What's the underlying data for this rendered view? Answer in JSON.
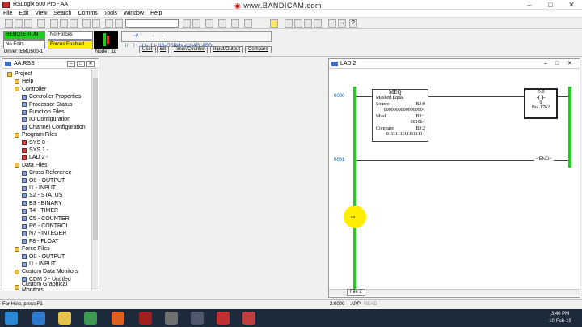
{
  "window": {
    "title": "RSLogix 500 Pro - AA",
    "overlay": "www.BANDICAM.com"
  },
  "menu": [
    "File",
    "Edit",
    "View",
    "Search",
    "Comms",
    "Tools",
    "Window",
    "Help"
  ],
  "status_panel": {
    "mode": "REMOTE RUN",
    "forces": "No Forces",
    "edits": "No Edits",
    "forces_enabled": "Forces Enabled",
    "driver": "Driver: EMU500-1",
    "node": "Node : 1d"
  },
  "rung_toolbar": [
    "⊣⊢",
    "⊣/⊢",
    "-( )-",
    "-(L)-",
    "-(U)-",
    "OSR",
    "<I>",
    "<U>",
    "ABL",
    "ABS"
  ],
  "instruction_tabs": [
    "User",
    "Bit",
    "Timer/Counter",
    "Input/Output",
    "Compare"
  ],
  "project": {
    "title": "AA.RSS",
    "items": [
      {
        "label": "Project",
        "indent": 0,
        "icon": "f"
      },
      {
        "label": "Help",
        "indent": 1,
        "icon": "f"
      },
      {
        "label": "Controller",
        "indent": 1,
        "icon": "f"
      },
      {
        "label": "Controller Properties",
        "indent": 2,
        "icon": "d"
      },
      {
        "label": "Processor Status",
        "indent": 2,
        "icon": "d"
      },
      {
        "label": "Function Files",
        "indent": 2,
        "icon": "d"
      },
      {
        "label": "IO Configuration",
        "indent": 2,
        "icon": "d"
      },
      {
        "label": "Channel Configuration",
        "indent": 2,
        "icon": "d"
      },
      {
        "label": "Program Files",
        "indent": 1,
        "icon": "f"
      },
      {
        "label": "SYS 0 -",
        "indent": 2,
        "icon": "r"
      },
      {
        "label": "SYS 1 -",
        "indent": 2,
        "icon": "r"
      },
      {
        "label": "LAD 2 -",
        "indent": 2,
        "icon": "r"
      },
      {
        "label": "Data Files",
        "indent": 1,
        "icon": "f"
      },
      {
        "label": "Cross Reference",
        "indent": 2,
        "icon": "d"
      },
      {
        "label": "O0 - OUTPUT",
        "indent": 2,
        "icon": "d"
      },
      {
        "label": "I1 - INPUT",
        "indent": 2,
        "icon": "d"
      },
      {
        "label": "S2 - STATUS",
        "indent": 2,
        "icon": "d"
      },
      {
        "label": "B3 - BINARY",
        "indent": 2,
        "icon": "d"
      },
      {
        "label": "T4 - TIMER",
        "indent": 2,
        "icon": "d"
      },
      {
        "label": "C5 - COUNTER",
        "indent": 2,
        "icon": "d"
      },
      {
        "label": "R6 - CONTROL",
        "indent": 2,
        "icon": "d"
      },
      {
        "label": "N7 - INTEGER",
        "indent": 2,
        "icon": "d"
      },
      {
        "label": "F8 - FLOAT",
        "indent": 2,
        "icon": "d"
      },
      {
        "label": "Force Files",
        "indent": 1,
        "icon": "f"
      },
      {
        "label": "O0 - OUTPUT",
        "indent": 2,
        "icon": "d"
      },
      {
        "label": "I1 - INPUT",
        "indent": 2,
        "icon": "d"
      },
      {
        "label": "Custom Data Monitors",
        "indent": 1,
        "icon": "f"
      },
      {
        "label": "CDM 0 - Untitled",
        "indent": 2,
        "icon": "d"
      },
      {
        "label": "Custom Graphical Monitors",
        "indent": 1,
        "icon": "f"
      }
    ]
  },
  "ladder": {
    "title": "LAD 2",
    "rungs": [
      "0000",
      "0001"
    ],
    "meq": {
      "name": "MEQ",
      "desc": "Masked Equal",
      "source_lbl": "Source",
      "source": "B3:0",
      "source_val": "0000000000000000<",
      "mask_lbl": "Mask",
      "mask": "B3:1",
      "mask_val": "0010h<",
      "compare_lbl": "Compare",
      "compare": "B3:2",
      "compare_val": "0111111111111111<"
    },
    "coil": {
      "addr": "O:0",
      "bit": "0",
      "label": "Bul.1762"
    },
    "end": "END",
    "file_tab": "File 2"
  },
  "statusbar": {
    "help": "For Help, press F1",
    "addr": "2:0000",
    "app": "APP",
    "read": "READ"
  },
  "clock": {
    "time": "3:40 PM",
    "date": "10-Feb-19"
  }
}
